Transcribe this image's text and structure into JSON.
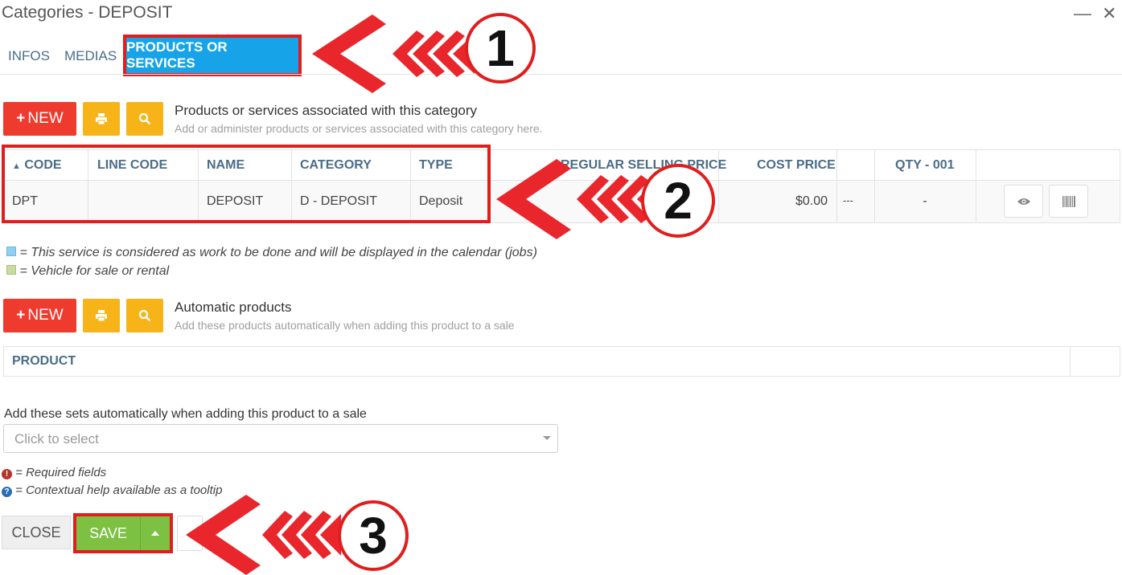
{
  "window": {
    "title": "Categories - DEPOSIT",
    "minimize_glyph": "—",
    "close_glyph": "✕"
  },
  "tabs": [
    {
      "label": "INFOS"
    },
    {
      "label": "MEDIAS"
    },
    {
      "label": "PRODUCTS OR SERVICES",
      "active": true
    }
  ],
  "toolbar": {
    "new_label": "NEW",
    "new_icon": "plus-icon",
    "print_icon": "print-icon",
    "search_icon": "search-icon"
  },
  "products_section": {
    "title": "Products or services associated with this category",
    "subtitle": "Add or administer products or services associated with this category here.",
    "sort_icon": "▲",
    "columns": [
      "CODE",
      "LINE CODE",
      "NAME",
      "CATEGORY",
      "TYPE",
      "REGULAR SELLING PRICE",
      "COST PRICE",
      "",
      "QTY - 001",
      ""
    ],
    "rows": [
      {
        "code": "DPT",
        "line_code": "",
        "name": "DEPOSIT",
        "category": "D - DEPOSIT",
        "type": "Deposit",
        "regular_price": "",
        "cost_price": "$0.00",
        "extra": "---",
        "qty": "-"
      }
    ]
  },
  "legend": {
    "service": "= This service is considered as work to be done and will be displayed in the calendar (jobs)",
    "vehicle": "= Vehicle for sale or rental",
    "service_color": "#8fd0f0",
    "vehicle_color": "#c8dba0"
  },
  "automatic_section": {
    "title": "Automatic products",
    "subtitle": "Add these products automatically when adding this product to a sale",
    "column": "PRODUCT"
  },
  "sets": {
    "label": "Add these sets automatically when adding this product to a sale",
    "placeholder": "Click to select"
  },
  "notes": {
    "required": "= Required fields",
    "help": "= Contextual help available as a tooltip"
  },
  "footer": {
    "close_label": "CLOSE",
    "save_label": "SAVE"
  },
  "annotations": [
    "1",
    "2",
    "3"
  ],
  "colors": {
    "accent_blue": "#16a3e8",
    "new_red": "#ef3a2e",
    "tool_yellow": "#f7b418",
    "save_green": "#7cc142",
    "header_text": "#4a6d88",
    "annotation_red": "#e11d1d"
  }
}
